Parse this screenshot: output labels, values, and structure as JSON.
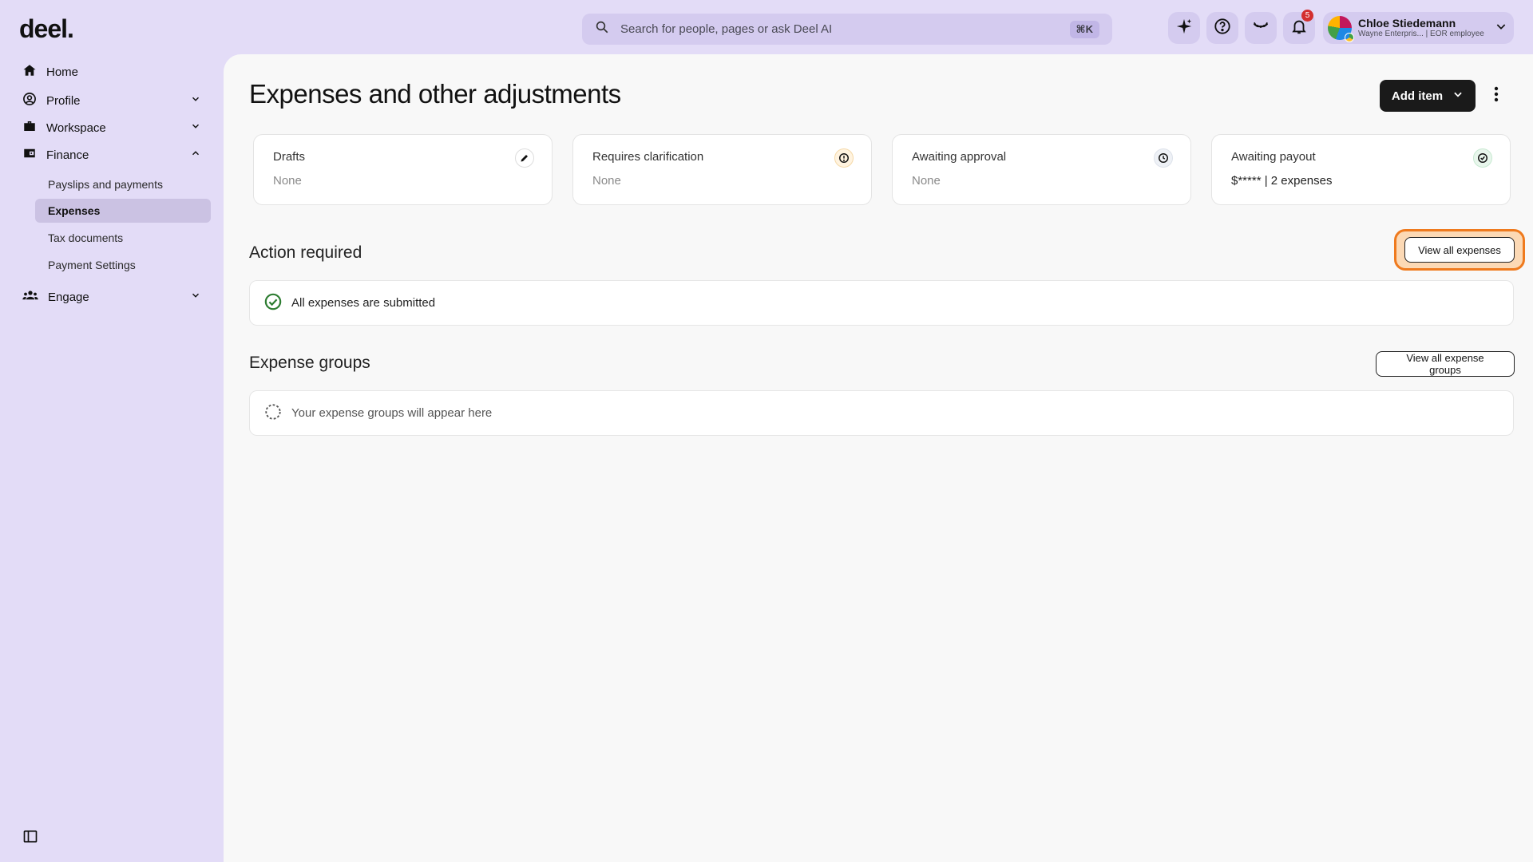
{
  "app": {
    "logo": "deel."
  },
  "search": {
    "placeholder": "Search for people, pages or ask Deel AI",
    "shortcut": "⌘K"
  },
  "topbar": {
    "icons": [
      "sparkle-icon",
      "help-icon",
      "eye-icon",
      "bell-icon"
    ],
    "notification_count": "5"
  },
  "user": {
    "name": "Chloe Stiedemann",
    "role": "Wayne Enterpris... | EOR employee"
  },
  "sidebar": {
    "items": [
      {
        "label": "Home",
        "icon": "home-icon"
      },
      {
        "label": "Profile",
        "icon": "profile-icon"
      },
      {
        "label": "Workspace",
        "icon": "briefcase-icon"
      },
      {
        "label": "Finance",
        "icon": "wallet-icon"
      },
      {
        "label": "Engage",
        "icon": "people-icon"
      }
    ],
    "finance_sub": [
      "Payslips and payments",
      "Expenses",
      "Tax documents",
      "Payment Settings"
    ],
    "active_sub": "Expenses"
  },
  "main": {
    "title": "Expenses and other adjustments",
    "add_item_label": "Add item",
    "cards": [
      {
        "title": "Drafts",
        "value": "None",
        "icon": "pencil-icon"
      },
      {
        "title": "Requires clarification",
        "value": "None",
        "icon": "alert-icon"
      },
      {
        "title": "Awaiting approval",
        "value": "None",
        "icon": "clock-icon"
      },
      {
        "title": "Awaiting payout",
        "value": "$***** | 2 expenses",
        "icon": "check-circle-icon"
      }
    ],
    "action_required": {
      "title": "Action required",
      "button_label": "View all expenses",
      "message": "All expenses are submitted"
    },
    "expense_groups": {
      "title": "Expense groups",
      "button_label": "View all expense groups",
      "message": "Your expense groups will appear here"
    }
  },
  "colors": {
    "sidebar_bg": "#e3dcf7",
    "active_item": "#cbc2e3",
    "highlight": "#ef7a1e",
    "success": "#2e7d32"
  }
}
